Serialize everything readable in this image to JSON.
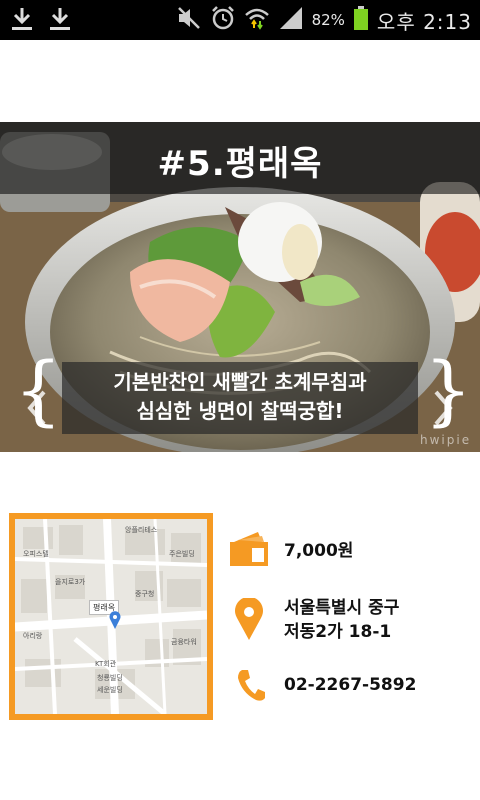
{
  "status_bar": {
    "battery": "82%",
    "time": "오후 2:13",
    "icons": [
      "download-icon",
      "download-icon",
      "mute-icon",
      "alarm-icon",
      "wifi-icon",
      "signal-icon",
      "battery-icon"
    ]
  },
  "hero": {
    "title": "#5.평래옥",
    "caption_line1": "기본반찬인 새빨간 초계무침과",
    "caption_line2": "심심한 냉면이 찰떡궁합!",
    "watermark": "hwipie"
  },
  "map": {
    "place_label": "평래옥",
    "labels": [
      "앙플리테스",
      "오피스텔",
      "을지로3가",
      "주은빌딩",
      "KT회관",
      "청룡빌딩",
      "세운빌딩",
      "중구청",
      "아리랑",
      "금융타워"
    ]
  },
  "info": {
    "price": "7,000원",
    "address_line1": "서울특별시 중구",
    "address_line2": "저동2가 18-1",
    "phone": "02-2267-5892"
  },
  "colors": {
    "accent": "#f59a23",
    "status_bar": "#000000",
    "battery": "#7ed321"
  }
}
